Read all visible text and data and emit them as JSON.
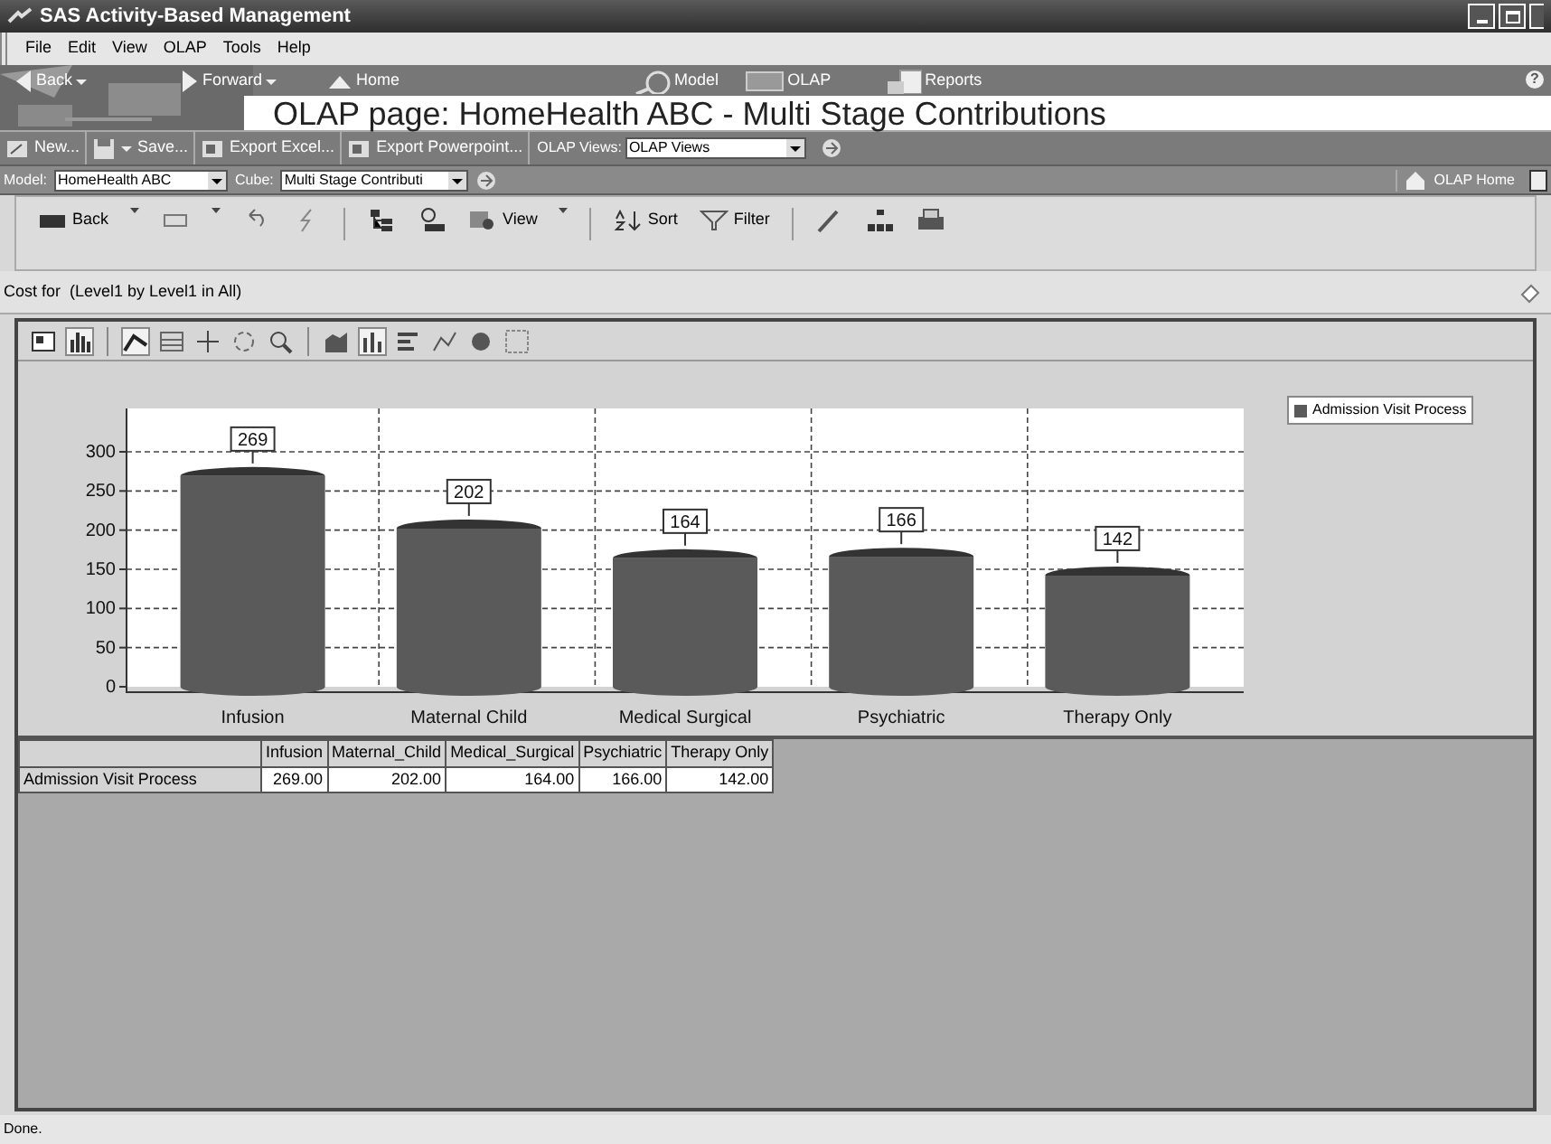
{
  "window": {
    "title": "SAS Activity-Based Management"
  },
  "menu": [
    "File",
    "Edit",
    "View",
    "OLAP",
    "Tools",
    "Help"
  ],
  "nav": [
    {
      "label": "Back",
      "kind": "back"
    },
    {
      "label": "Forward",
      "kind": "forward"
    },
    {
      "label": "Home",
      "kind": "home"
    },
    {
      "label": "Model",
      "kind": "model"
    },
    {
      "label": "OLAP",
      "kind": "olap"
    },
    {
      "label": "Reports",
      "kind": "reports"
    }
  ],
  "banner": {
    "title": "OLAP page: HomeHealth ABC - Multi Stage Contributions"
  },
  "page_toolbar": {
    "buttons": [
      "New...",
      "Save...",
      "Export Excel...",
      "Export Powerpoint..."
    ],
    "views_label": "OLAP Views:",
    "views_value": "OLAP Views"
  },
  "selectors": [
    {
      "label": "Model:",
      "value": "HomeHealth ABC"
    },
    {
      "label": "Cube:",
      "value": "Multi Stage Contributi"
    }
  ],
  "olap_home": "OLAP Home",
  "olap_toolbar": [
    "Back",
    "View",
    "Sort",
    "Filter"
  ],
  "caption": "Cost for  (Level1 by Level1 in All)",
  "chart_tool_groups": [
    {
      "tools": [
        {
          "kind": "properties",
          "selected": false
        },
        {
          "kind": "chart",
          "selected": true
        }
      ]
    },
    {
      "tools": [
        {
          "kind": "pointer",
          "selected": true
        },
        {
          "kind": "table",
          "selected": false
        },
        {
          "kind": "move",
          "selected": false
        },
        {
          "kind": "rotate",
          "selected": false
        },
        {
          "kind": "zoom",
          "selected": false
        }
      ]
    },
    {
      "tools": [
        {
          "kind": "area",
          "selected": false
        },
        {
          "kind": "bar",
          "selected": true
        },
        {
          "kind": "hbar",
          "selected": false
        },
        {
          "kind": "line",
          "selected": false
        },
        {
          "kind": "pie",
          "selected": false
        },
        {
          "kind": "scatter",
          "selected": false
        }
      ]
    }
  ],
  "chart_data": {
    "type": "bar",
    "categories": [
      "Infusion",
      "Maternal  Child",
      "Medical  Surgical",
      "Psychiatric",
      "Therapy Only"
    ],
    "series": [
      {
        "name": "Admission Visit Process",
        "color": "#5a5a5a",
        "values": [
          269,
          202,
          164,
          166,
          142
        ]
      }
    ],
    "grid": true,
    "ylim": [
      0,
      300
    ],
    "yticks": [
      0,
      50,
      100,
      150,
      200,
      250,
      300
    ],
    "data_labels": true
  },
  "table": {
    "columns": [
      "Infusion",
      "Maternal_Child",
      "Medical_Surgical",
      "Psychiatric",
      "Therapy Only"
    ],
    "rows": [
      {
        "label": "Admission Visit Process",
        "cells": [
          "269.00",
          "202.00",
          "164.00",
          "166.00",
          "142.00"
        ]
      }
    ]
  },
  "status_bar": "Done.",
  "help": "?"
}
